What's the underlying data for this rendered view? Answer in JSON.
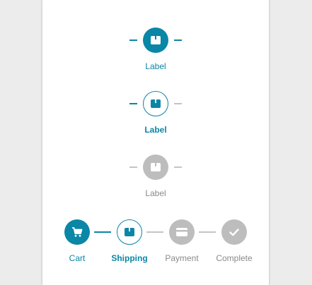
{
  "single_steps": [
    {
      "state": "active",
      "label": "Label",
      "icon": "box-icon"
    },
    {
      "state": "current",
      "label": "Label",
      "icon": "box-icon"
    },
    {
      "state": "disabled",
      "label": "Label",
      "icon": "box-icon"
    }
  ],
  "stepper": {
    "steps": [
      {
        "state": "active",
        "label": "Cart",
        "icon": "cart-icon"
      },
      {
        "state": "current",
        "label": "Shipping",
        "icon": "box-icon"
      },
      {
        "state": "disabled",
        "label": "Payment",
        "icon": "credit-card-icon"
      },
      {
        "state": "disabled",
        "label": "Complete",
        "icon": "check-icon"
      }
    ]
  },
  "colors": {
    "accent": "#0a86a6",
    "disabled": "#bdbdbd",
    "muted_text": "#8a8a8a"
  }
}
